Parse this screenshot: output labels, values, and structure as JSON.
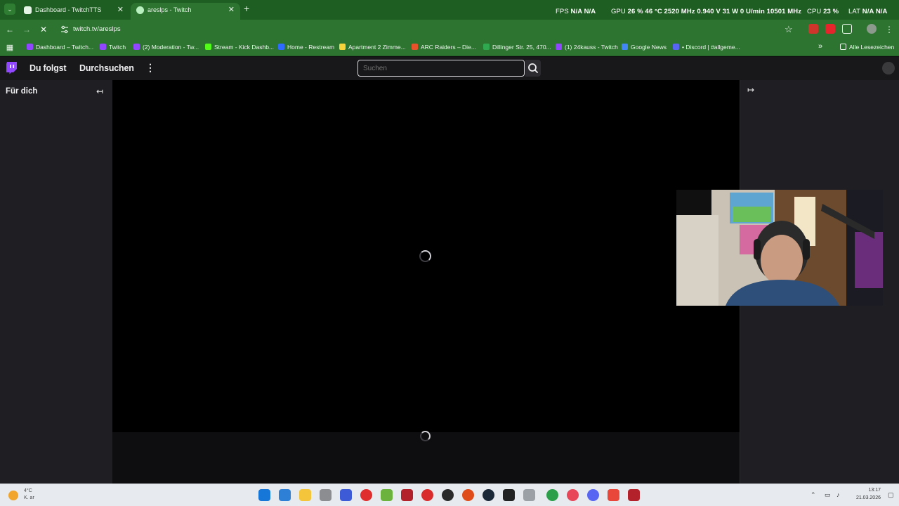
{
  "browser": {
    "tabs": [
      {
        "title": "Dashboard - TwitchTTS",
        "active": false
      },
      {
        "title": "areslps - Twitch",
        "active": true
      }
    ],
    "tab_close": "✕",
    "new_tab": "+",
    "url": "twitch.tv/areslps"
  },
  "osd": {
    "fps_label": "FPS",
    "fps_value": "N/A  N/A",
    "gpu_label": "GPU",
    "gpu_value": "26 %  46 °C  2520 MHz  0.940 V  31 W  0 U/min  10501 MHz",
    "cpu_label": "CPU",
    "cpu_value": "23 %",
    "lat_label": "LAT",
    "lat_value": "N/A  N/A"
  },
  "bookmarks": [
    {
      "label": "Dashboard – Twitch...",
      "color": "#9146ff"
    },
    {
      "label": "Twitch",
      "color": "#9146ff"
    },
    {
      "label": "(2) Moderation - Tw...",
      "color": "#9146ff"
    },
    {
      "label": "Stream - Kick Dashb...",
      "color": "#53fc18"
    },
    {
      "label": "Home - Restream",
      "color": "#2f6bff"
    },
    {
      "label": "Apartment 2 Zimme...",
      "color": "#f7d33b"
    },
    {
      "label": "ARC Raiders – Die...",
      "color": "#e8532c"
    },
    {
      "label": "Dillinger Str. 25, 470...",
      "color": "#2fa84f"
    },
    {
      "label": "(1) 24kauss - Twitch",
      "color": "#9146ff"
    },
    {
      "label": "Google News",
      "color": "#4285f4"
    },
    {
      "label": "• Discord | #allgeme...",
      "color": "#5865f2"
    }
  ],
  "bookmarks_more": "»",
  "all_bookmarks": "Alle Lesezeichen",
  "twitch": {
    "following": "Du folgst",
    "browse": "Durchsuchen",
    "more": "⋮",
    "search_placeholder": "Suchen",
    "sidebar_title": "Für dich",
    "collapse_arrow": "↤",
    "expand_arrow": "↦",
    "brand_color": "#9146ff"
  },
  "taskbar": {
    "weather_temp": "4°C",
    "weather_cond": "K. ar",
    "time": "13:17",
    "date": "21.03.2026"
  }
}
